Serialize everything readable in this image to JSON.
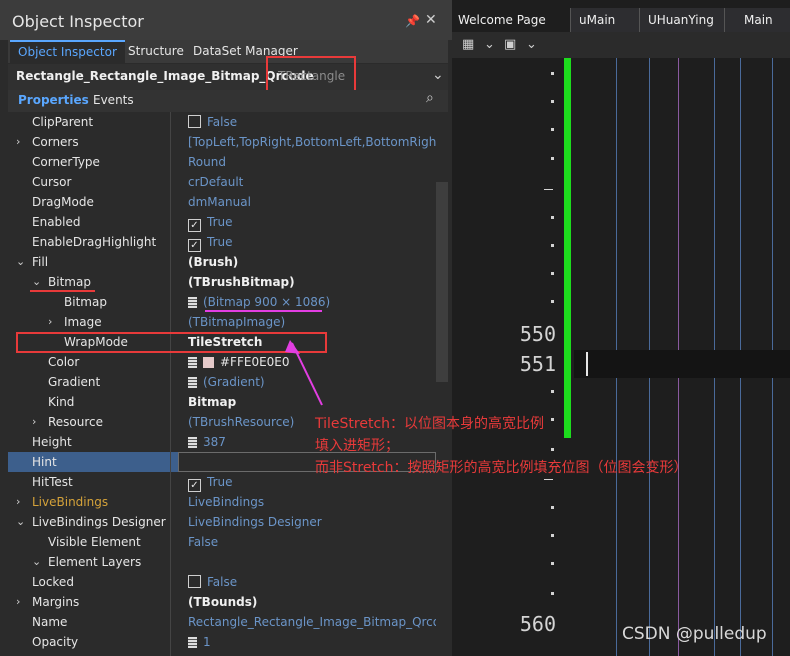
{
  "inspector": {
    "title": "Object Inspector",
    "pin_icon": "pin-icon",
    "close_icon": "close-icon",
    "tabs": [
      "Object Inspector",
      "Structure",
      "DataSet Manager"
    ],
    "object_name": "Rectangle_Rectangle_Image_Bitmap_Qrcode",
    "object_type": "TRectangle",
    "subtabs": [
      "Properties",
      "Events"
    ],
    "properties": [
      {
        "name": "ClipParent",
        "value": "False",
        "check": "unchecked"
      },
      {
        "name": "Corners",
        "value": "[TopLeft,TopRight,BottomLeft,BottomRight]",
        "expand": "›"
      },
      {
        "name": "CornerType",
        "value": "Round"
      },
      {
        "name": "Cursor",
        "value": "crDefault"
      },
      {
        "name": "DragMode",
        "value": "dmManual"
      },
      {
        "name": "Enabled",
        "value": "True",
        "check": "checked"
      },
      {
        "name": "EnableDragHighlight",
        "value": "True",
        "check": "checked"
      },
      {
        "name": "Fill",
        "value": "(Brush)",
        "expand": "⌄"
      },
      {
        "name": "Bitmap",
        "value": "(TBrushBitmap)",
        "expand": "⌄"
      },
      {
        "name": "Bitmap",
        "value": "(Bitmap 900 × 1086)"
      },
      {
        "name": "Image",
        "value": "(TBitmapImage)",
        "expand": "›"
      },
      {
        "name": "WrapMode",
        "value": "TileStretch"
      },
      {
        "name": "Color",
        "value": "#FFE0E0E0"
      },
      {
        "name": "Gradient",
        "value": "(Gradient)"
      },
      {
        "name": "Kind",
        "value": "Bitmap"
      },
      {
        "name": "Resource",
        "value": "(TBrushResource)",
        "expand": "›"
      },
      {
        "name": "Height",
        "value": "387"
      },
      {
        "name": "Hint",
        "value": ""
      },
      {
        "name": "HitTest",
        "value": "True",
        "check": "checked"
      },
      {
        "name": "LiveBindings",
        "value": "LiveBindings",
        "expand": "›"
      },
      {
        "name": "LiveBindings Designer",
        "value": "LiveBindings Designer",
        "expand": "⌄"
      },
      {
        "name": "Visible Element",
        "value": "False"
      },
      {
        "name": "Element Layers",
        "value": "",
        "expand": "⌄"
      },
      {
        "name": "Locked",
        "value": "False",
        "check": "unchecked"
      },
      {
        "name": "Margins",
        "value": "(TBounds)",
        "expand": "›"
      },
      {
        "name": "Name",
        "value": "Rectangle_Rectangle_Image_Bitmap_Qrcode"
      },
      {
        "name": "Opacity",
        "value": "1"
      }
    ]
  },
  "editor": {
    "tabs": [
      "Welcome Page",
      "uMain",
      "UHuanYing",
      "Main"
    ],
    "line_numbers": [
      "550",
      "551",
      "560"
    ]
  },
  "annotation": {
    "line1": "TileStretch：以位图本身的高宽比例",
    "line2": "填入进矩形；",
    "line3": "而非Stretch：按照矩形的高宽比例填充位图（位图会变形）"
  },
  "watermark": "CSDN @pulledup",
  "colors": {
    "accent": "#5aa7ff",
    "annotation_red": "#e83a3a",
    "arrow_magenta": "#e23ee2",
    "gutter_green": "#1ddc1d",
    "selection_blue": "#3d5f8c"
  }
}
